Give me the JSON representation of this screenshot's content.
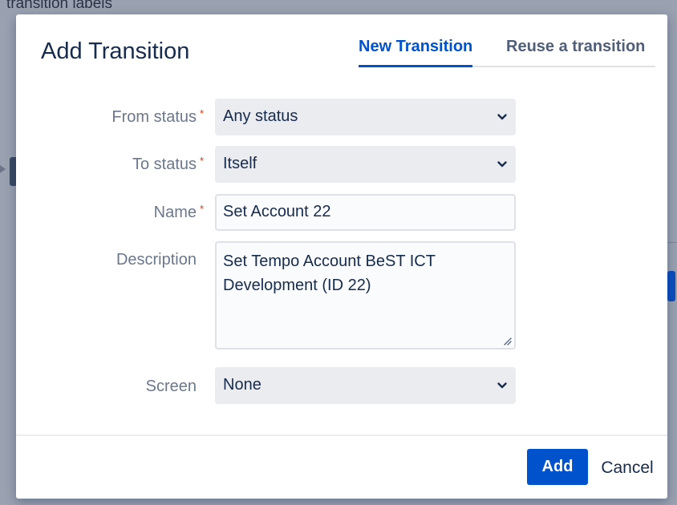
{
  "backdrop": {
    "title": "transition labels"
  },
  "dialog": {
    "title": "Add Transition",
    "tabs": [
      {
        "label": "New Transition",
        "active": true
      },
      {
        "label": "Reuse a transition",
        "active": false
      }
    ]
  },
  "form": {
    "from_status": {
      "label": "From status",
      "required_mark": "*",
      "value": "Any status"
    },
    "to_status": {
      "label": "To status",
      "required_mark": "*",
      "value": "Itself"
    },
    "name": {
      "label": "Name",
      "required_mark": "*",
      "value": "Set Account 22"
    },
    "description": {
      "label": "Description",
      "value": "Set Tempo Account BeST ICT Development (ID 22)"
    },
    "screen": {
      "label": "Screen",
      "value": "None"
    }
  },
  "footer": {
    "add_label": "Add",
    "cancel_label": "Cancel"
  },
  "colors": {
    "accent": "#0052cc",
    "required": "#de350b",
    "overlay": "#9aa2b1"
  },
  "icons": {
    "select_caret": "chevron-down-icon",
    "resize": "resize-grip-icon"
  }
}
